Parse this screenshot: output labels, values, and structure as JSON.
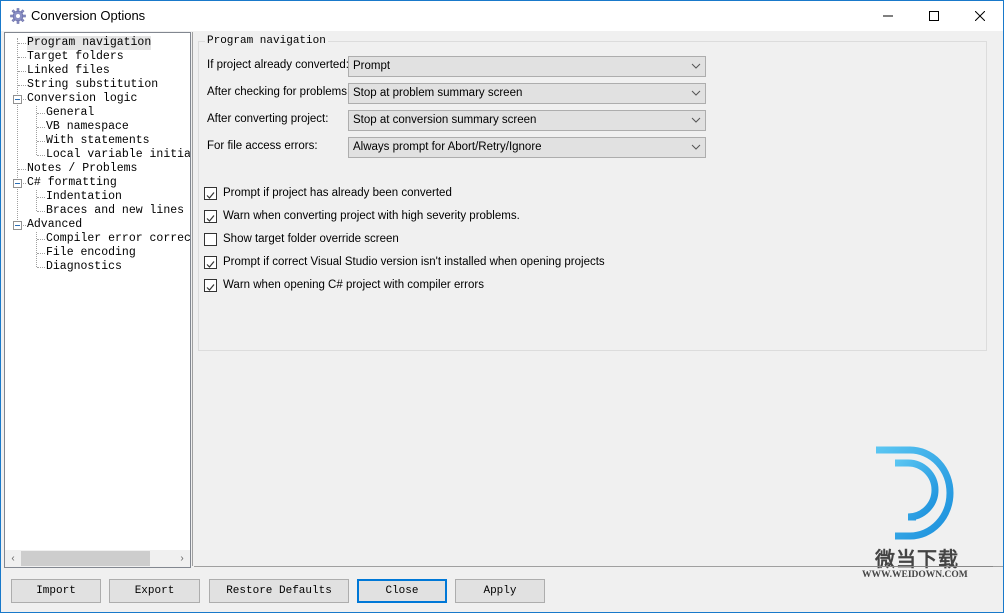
{
  "window": {
    "title": "Conversion Options",
    "controls": {
      "minimize": "minimize",
      "maximize": "maximize",
      "close": "close"
    }
  },
  "tree": {
    "items": [
      {
        "label": "Program navigation",
        "level": 0,
        "selected": true
      },
      {
        "label": "Target folders",
        "level": 0
      },
      {
        "label": "Linked files",
        "level": 0
      },
      {
        "label": "String substitution",
        "level": 0
      },
      {
        "label": "Conversion logic",
        "level": 0,
        "expanded": true
      },
      {
        "label": "General",
        "level": 1
      },
      {
        "label": "VB namespace",
        "level": 1
      },
      {
        "label": "With statements",
        "level": 1
      },
      {
        "label": "Local variable initializ",
        "level": 1
      },
      {
        "label": "Notes / Problems",
        "level": 0
      },
      {
        "label": "C# formatting",
        "level": 0,
        "expanded": true
      },
      {
        "label": "Indentation",
        "level": 1
      },
      {
        "label": "Braces and new lines",
        "level": 1
      },
      {
        "label": "Advanced",
        "level": 0,
        "expanded": true
      },
      {
        "label": "Compiler error correctic",
        "level": 1
      },
      {
        "label": "File encoding",
        "level": 1
      },
      {
        "label": "Diagnostics",
        "level": 1
      }
    ]
  },
  "panel": {
    "group_title": "Program navigation",
    "fields": [
      {
        "label": "If project already converted:",
        "value": "Prompt"
      },
      {
        "label": "After checking for problems:",
        "value": "Stop at problem summary screen"
      },
      {
        "label": "After converting project:",
        "value": "Stop at conversion summary screen"
      },
      {
        "label": "For file access errors:",
        "value": "Always prompt for Abort/Retry/Ignore"
      }
    ],
    "checkboxes": [
      {
        "label": "Prompt if project has already been converted",
        "checked": true
      },
      {
        "label": "Warn when converting project with high severity problems.",
        "checked": true
      },
      {
        "label": "Show target folder override screen",
        "checked": false
      },
      {
        "label": "Prompt if correct Visual Studio version isn't installed when opening projects",
        "checked": true
      },
      {
        "label": "Warn when opening C# project with compiler errors",
        "checked": true
      }
    ]
  },
  "buttons": {
    "import": "Import",
    "export": "Export",
    "restore_defaults": "Restore Defaults",
    "close": "Close",
    "apply": "Apply"
  },
  "watermark": {
    "brand": "微当下载",
    "url": "WWW.WEIDOWN.COM",
    "color": "#1a9be0"
  }
}
